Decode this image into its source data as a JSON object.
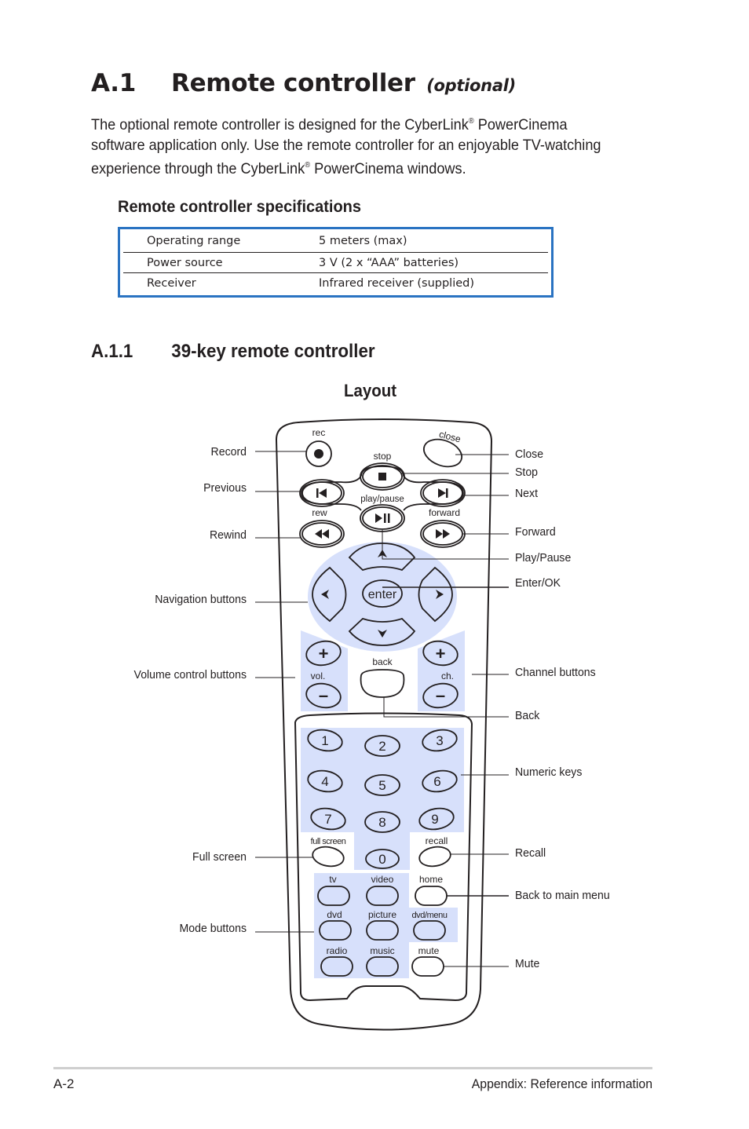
{
  "heading": {
    "number": "A.1",
    "title": "Remote controller",
    "qualifier": "(optional)"
  },
  "intro": {
    "line1_pre": "The optional remote controller is designed for the CyberLink",
    "line1_post": " PowerCinema",
    "line2": "software application only. Use the remote controller for an enjoyable TV-watching",
    "line3_pre": "experience through the CyberLink",
    "line3_post": " PowerCinema windows.",
    "registered_mark": "®"
  },
  "specs": {
    "title": "Remote controller specifications",
    "border_color": "#2a73c2",
    "rows": [
      {
        "label": "Operating range",
        "value": "5 meters (max)"
      },
      {
        "label": "Power source",
        "value": "3 V (2 x “AAA” batteries)"
      },
      {
        "label": "Receiver",
        "value": "Infrared receiver (supplied)"
      }
    ]
  },
  "subsection": {
    "number": "A.1.1",
    "title": "39-key remote controller",
    "layout_title": "Layout"
  },
  "remote": {
    "highlight_color": "#d7e0fb",
    "keys": {
      "rec": "rec",
      "close": "close",
      "stop": "stop",
      "play_pause": "play/pause",
      "rew": "rew",
      "forward": "forward",
      "enter": "enter",
      "vol": "vol.",
      "ch": "ch.",
      "back": "back",
      "plus": "+",
      "minus": "–",
      "numbers": [
        "1",
        "2",
        "3",
        "4",
        "5",
        "6",
        "7",
        "8",
        "9",
        "0"
      ],
      "full_screen": "full screen",
      "recall": "recall",
      "tv": "tv",
      "video": "video",
      "home": "home",
      "dvd": "dvd",
      "picture": "picture",
      "dvd_menu": "dvd/menu",
      "radio": "radio",
      "music": "music",
      "mute": "mute"
    }
  },
  "callouts": {
    "left": [
      "Record",
      "Previous",
      "Rewind",
      "Navigation buttons",
      "Volume control buttons",
      "Full screen",
      "Mode buttons"
    ],
    "right": [
      "Close",
      "Stop",
      "Next",
      "Forward",
      "Play/Pause",
      "Enter/OK",
      "Channel buttons",
      "Back",
      "Numeric keys",
      "Recall",
      "Back to main menu",
      "Mute"
    ]
  },
  "footer": {
    "page": "A-2",
    "section": "Appendix: Reference information"
  }
}
